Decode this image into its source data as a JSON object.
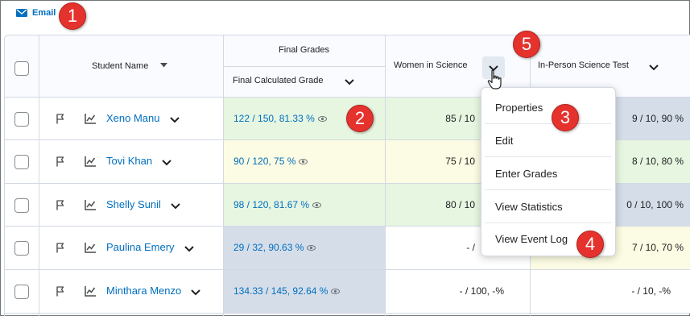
{
  "toolbar": {
    "email_label": "Email"
  },
  "badges": {
    "one": "1",
    "two": "2",
    "three": "3",
    "four": "4",
    "five": "5"
  },
  "header": {
    "student_name": "Student Name",
    "final_grades": "Final Grades",
    "final_calculated_grade": "Final Calculated Grade",
    "women_in_science": "Women in Science",
    "in_person_test": "In-Person Science Test"
  },
  "rows": [
    {
      "name": "Xeno Manu",
      "final": "122 / 150, 81.33 %",
      "wis": "85 / 10",
      "ipt": "9 / 10, 90 %",
      "final_bg": "#e6f6e1",
      "wis_bg": "#e6f6e1",
      "ipt_bg": "#d5dde9"
    },
    {
      "name": "Tovi Khan",
      "final": "90 / 120, 75 %",
      "wis": "75 / 10",
      "ipt": "8 / 10, 80 %",
      "final_bg": "#fcfbe3",
      "wis_bg": "#fcfbe3",
      "ipt_bg": "#e6f6e1"
    },
    {
      "name": "Shelly Sunil",
      "final": "98 / 120, 81.67 %",
      "wis": "80 / 10",
      "ipt": "0 / 10, 100 %",
      "final_bg": "#e6f6e1",
      "wis_bg": "#e6f6e1",
      "ipt_bg": "#d5dde9"
    },
    {
      "name": "Paulina Emery",
      "final": "29 / 32, 90.63 %",
      "wis": "- /",
      "ipt": "7 / 10, 70 %",
      "final_bg": "#d5dde9",
      "wis_bg": "#ffffff",
      "ipt_bg": "#fcfbe3"
    },
    {
      "name": "Minthara Menzo",
      "final": "134.33 / 145, 92.64 %",
      "wis": "- / 100, -%",
      "ipt": "- / 10, -%",
      "final_bg": "#d5dde9",
      "wis_bg": "#ffffff",
      "ipt_bg": "#ffffff"
    }
  ],
  "menu": {
    "properties": "Properties",
    "edit": "Edit",
    "enter_grades": "Enter Grades",
    "view_statistics": "View Statistics",
    "view_event_log": "View Event Log"
  },
  "colors": {
    "link": "#006fbf",
    "badge": "#e5322d",
    "header_bg": "#f9fbff",
    "border": "#d3d9e3"
  }
}
